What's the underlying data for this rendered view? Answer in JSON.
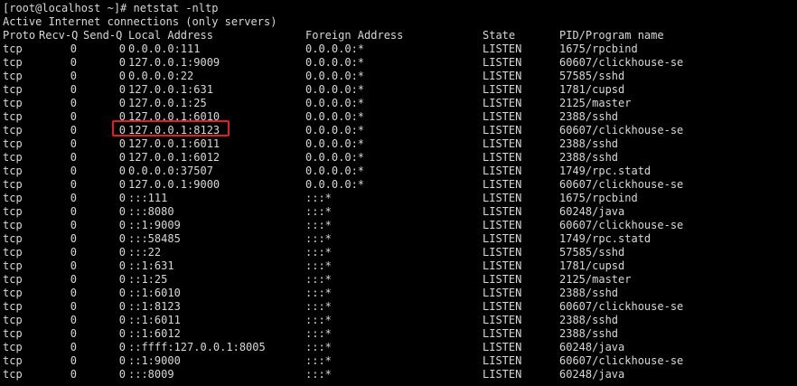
{
  "terminal": {
    "prompt_line": "[root@localhost ~]# netstat -nltp",
    "subtitle": "Active Internet connections (only servers)",
    "header": {
      "proto": "Proto",
      "recvq": "Recv-Q",
      "sendq": "Send-Q",
      "local": "Local Address",
      "foreign": "Foreign Address",
      "state": "State",
      "pid": "PID/Program name"
    },
    "rows": [
      {
        "proto": "tcp",
        "recvq": "0",
        "sendq": "0",
        "local": "0.0.0.0:111",
        "foreign": "0.0.0.0:*",
        "state": "LISTEN",
        "pid": "1675/rpcbind"
      },
      {
        "proto": "tcp",
        "recvq": "0",
        "sendq": "0",
        "local": "127.0.0.1:9009",
        "foreign": "0.0.0.0:*",
        "state": "LISTEN",
        "pid": "60607/clickhouse-se"
      },
      {
        "proto": "tcp",
        "recvq": "0",
        "sendq": "0",
        "local": "0.0.0.0:22",
        "foreign": "0.0.0.0:*",
        "state": "LISTEN",
        "pid": "57585/sshd"
      },
      {
        "proto": "tcp",
        "recvq": "0",
        "sendq": "0",
        "local": "127.0.0.1:631",
        "foreign": "0.0.0.0:*",
        "state": "LISTEN",
        "pid": "1781/cupsd"
      },
      {
        "proto": "tcp",
        "recvq": "0",
        "sendq": "0",
        "local": "127.0.0.1:25",
        "foreign": "0.0.0.0:*",
        "state": "LISTEN",
        "pid": "2125/master"
      },
      {
        "proto": "tcp",
        "recvq": "0",
        "sendq": "0",
        "local": "127.0.0.1:6010",
        "foreign": "0.0.0.0:*",
        "state": "LISTEN",
        "pid": "2388/sshd"
      },
      {
        "proto": "tcp",
        "recvq": "0",
        "sendq": "0",
        "local": "127.0.0.1:8123",
        "foreign": "0.0.0.0:*",
        "state": "LISTEN",
        "pid": "60607/clickhouse-se"
      },
      {
        "proto": "tcp",
        "recvq": "0",
        "sendq": "0",
        "local": "127.0.0.1:6011",
        "foreign": "0.0.0.0:*",
        "state": "LISTEN",
        "pid": "2388/sshd"
      },
      {
        "proto": "tcp",
        "recvq": "0",
        "sendq": "0",
        "local": "127.0.0.1:6012",
        "foreign": "0.0.0.0:*",
        "state": "LISTEN",
        "pid": "2388/sshd"
      },
      {
        "proto": "tcp",
        "recvq": "0",
        "sendq": "0",
        "local": "0.0.0.0:37507",
        "foreign": "0.0.0.0:*",
        "state": "LISTEN",
        "pid": "1749/rpc.statd"
      },
      {
        "proto": "tcp",
        "recvq": "0",
        "sendq": "0",
        "local": "127.0.0.1:9000",
        "foreign": "0.0.0.0:*",
        "state": "LISTEN",
        "pid": "60607/clickhouse-se"
      },
      {
        "proto": "tcp",
        "recvq": "0",
        "sendq": "0",
        "local": ":::111",
        "foreign": ":::*",
        "state": "LISTEN",
        "pid": "1675/rpcbind"
      },
      {
        "proto": "tcp",
        "recvq": "0",
        "sendq": "0",
        "local": ":::8080",
        "foreign": ":::*",
        "state": "LISTEN",
        "pid": "60248/java"
      },
      {
        "proto": "tcp",
        "recvq": "0",
        "sendq": "0",
        "local": "::1:9009",
        "foreign": ":::*",
        "state": "LISTEN",
        "pid": "60607/clickhouse-se"
      },
      {
        "proto": "tcp",
        "recvq": "0",
        "sendq": "0",
        "local": ":::58485",
        "foreign": ":::*",
        "state": "LISTEN",
        "pid": "1749/rpc.statd"
      },
      {
        "proto": "tcp",
        "recvq": "0",
        "sendq": "0",
        "local": ":::22",
        "foreign": ":::*",
        "state": "LISTEN",
        "pid": "57585/sshd"
      },
      {
        "proto": "tcp",
        "recvq": "0",
        "sendq": "0",
        "local": "::1:631",
        "foreign": ":::*",
        "state": "LISTEN",
        "pid": "1781/cupsd"
      },
      {
        "proto": "tcp",
        "recvq": "0",
        "sendq": "0",
        "local": "::1:25",
        "foreign": ":::*",
        "state": "LISTEN",
        "pid": "2125/master"
      },
      {
        "proto": "tcp",
        "recvq": "0",
        "sendq": "0",
        "local": "::1:6010",
        "foreign": ":::*",
        "state": "LISTEN",
        "pid": "2388/sshd"
      },
      {
        "proto": "tcp",
        "recvq": "0",
        "sendq": "0",
        "local": "::1:8123",
        "foreign": ":::*",
        "state": "LISTEN",
        "pid": "60607/clickhouse-se"
      },
      {
        "proto": "tcp",
        "recvq": "0",
        "sendq": "0",
        "local": "::1:6011",
        "foreign": ":::*",
        "state": "LISTEN",
        "pid": "2388/sshd"
      },
      {
        "proto": "tcp",
        "recvq": "0",
        "sendq": "0",
        "local": "::1:6012",
        "foreign": ":::*",
        "state": "LISTEN",
        "pid": "2388/sshd"
      },
      {
        "proto": "tcp",
        "recvq": "0",
        "sendq": "0",
        "local": "::ffff:127.0.0.1:8005",
        "foreign": ":::*",
        "state": "LISTEN",
        "pid": "60248/java"
      },
      {
        "proto": "tcp",
        "recvq": "0",
        "sendq": "0",
        "local": "::1:9000",
        "foreign": ":::*",
        "state": "LISTEN",
        "pid": "60607/clickhouse-se"
      },
      {
        "proto": "tcp",
        "recvq": "0",
        "sendq": "0",
        "local": ":::8009",
        "foreign": ":::*",
        "state": "LISTEN",
        "pid": "60248/java"
      }
    ],
    "highlighted_row_index": 6,
    "colors": {
      "background": "#000000",
      "text": "#d8d8d8",
      "highlight": "#e02020"
    }
  }
}
